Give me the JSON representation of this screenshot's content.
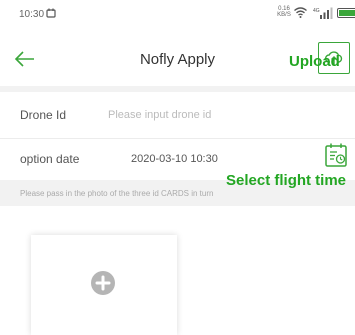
{
  "status_bar": {
    "time": "10:30",
    "net_speed_value": "0.16",
    "net_speed_unit": "KB/S",
    "network_type": "4G"
  },
  "nav": {
    "title": "Nofly Apply",
    "upload_annotation": "Upload"
  },
  "form": {
    "drone_id_label": "Drone Id",
    "drone_id_value": "",
    "drone_id_placeholder": "Please input drone id",
    "option_date_label": "option date",
    "option_date_value": "2020-03-10 10:30",
    "select_time_annotation": "Select flight time"
  },
  "hint": "Please pass in the photo of the three id CARDS in turn",
  "colors": {
    "accent_green": "#23a623",
    "page_background": "#ffffff",
    "band_background": "#f2f2f2"
  },
  "icons": {
    "back": "arrow-left",
    "upload": "cloud-upload",
    "calendar": "calendar-clock",
    "add_photo": "plus-circle"
  }
}
